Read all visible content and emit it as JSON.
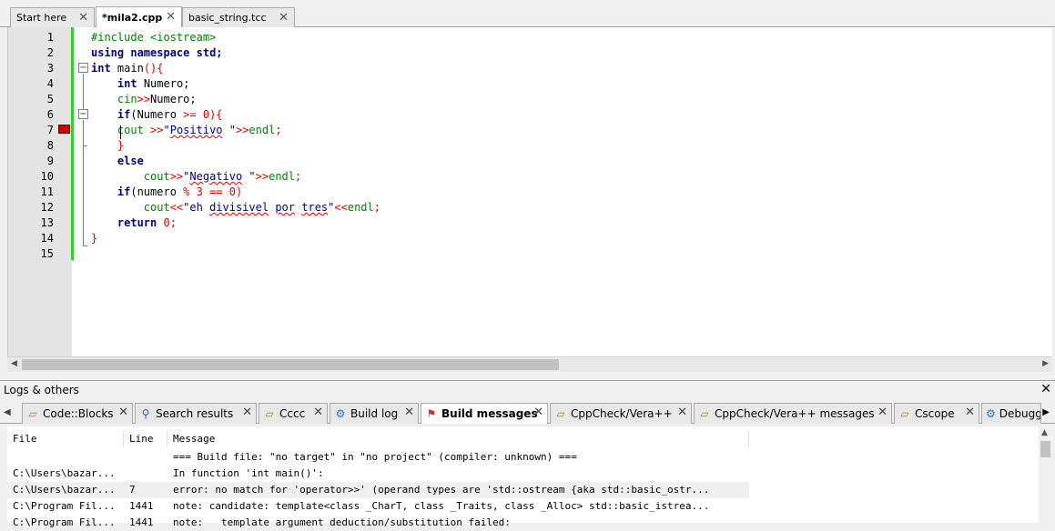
{
  "editor_tabs": [
    {
      "label": "Start here",
      "active": false
    },
    {
      "label": "*mila2.cpp",
      "active": true
    },
    {
      "label": "basic_string.tcc",
      "active": false
    }
  ],
  "tab_close_glyph": "✕",
  "code_lines": [
    {
      "num": "1"
    },
    {
      "num": "2"
    },
    {
      "num": "3"
    },
    {
      "num": "4"
    },
    {
      "num": "5"
    },
    {
      "num": "6"
    },
    {
      "num": "7"
    },
    {
      "num": "8"
    },
    {
      "num": "9"
    },
    {
      "num": "10"
    },
    {
      "num": "11"
    },
    {
      "num": "12"
    },
    {
      "num": "13"
    },
    {
      "num": "14"
    },
    {
      "num": "15"
    }
  ],
  "code": {
    "l1": "#include <iostream>",
    "l2_kw1": "using",
    "l2_kw2": "namespace",
    "l2_rest": "std;",
    "l3_kw": "int",
    "l3_name": "main",
    "l3_paren": "(){",
    "l4_kw": "int",
    "l4_rest": "Numero;",
    "l5_a": "cin",
    "l5_op": ">>",
    "l5_b": "Numero;",
    "l6_kw": "if",
    "l6_a": "(Numero ",
    "l6_op": ">=",
    "l6_num": "0",
    "l6_end": "){",
    "l7_a": "cout ",
    "l7_op": ">>",
    "l7_q1": "\"",
    "l7_word": "Positivo",
    "l7_q2": " \"",
    "l7_op2": ">>",
    "l7_endl": "endl",
    "l7_semi": ";",
    "l8": "}",
    "l9": "else",
    "l10_a": "cout",
    "l10_op": ">>",
    "l10_q1": "\"",
    "l10_word": "Negativo",
    "l10_q2": " \"",
    "l10_op2": ">>",
    "l10_endl": "endl",
    "l10_semi": ";",
    "l11_kw": "if",
    "l11_a": "(numero ",
    "l11_op": "%",
    "l11_num": "3",
    "l11_op2": "==",
    "l11_num2": "0",
    "l11_end": ")",
    "l12_a": "cout",
    "l12_op": "<<",
    "l12_q1": "\"eh ",
    "l12_w1": "divisivel",
    "l12_sp1": " ",
    "l12_w2": "por",
    "l12_sp2": " ",
    "l12_w3": "tres",
    "l12_q2": "\"",
    "l12_op2": "<<",
    "l12_endl": "endl",
    "l12_semi": ";",
    "l13_kw": "return",
    "l13_num": "0",
    "l13_semi": ";",
    "l14": "}"
  },
  "logs": {
    "title": "Logs & others",
    "close": "✕",
    "tabs": [
      {
        "label": "Code::Blocks",
        "icon": "document-icon"
      },
      {
        "label": "Search results",
        "icon": "magnifier-icon"
      },
      {
        "label": "Cccc",
        "icon": "document-icon"
      },
      {
        "label": "Build log",
        "icon": "gear-icon"
      },
      {
        "label": "Build messages",
        "icon": "pin-icon",
        "active": true
      },
      {
        "label": "CppCheck/Vera++",
        "icon": "document-icon"
      },
      {
        "label": "CppCheck/Vera++ messages",
        "icon": "document-icon"
      },
      {
        "label": "Cscope",
        "icon": "document-icon"
      },
      {
        "label": "Debugge",
        "icon": "gear-icon"
      }
    ],
    "columns": [
      "File",
      "Line",
      "Message"
    ],
    "rows": [
      {
        "file": "",
        "line": "",
        "message": "=== Build file: \"no target\" in \"no project\" (compiler: unknown) ==="
      },
      {
        "file": "C:\\Users\\bazar...",
        "line": "",
        "message": "In function 'int main()':"
      },
      {
        "file": "C:\\Users\\bazar...",
        "line": "7",
        "message": "error: no match for 'operator>>' (operand types are 'std::ostream {aka std::basic_ostr..."
      },
      {
        "file": "C:\\Program Fil...",
        "line": "1441",
        "message": "note: candidate: template<class _CharT, class _Traits, class _Alloc> std::basic_istrea..."
      },
      {
        "file": "C:\\Program Fil...",
        "line": "1441",
        "message": "note:   template argument deduction/substitution failed:"
      }
    ]
  },
  "colors": {
    "keyword": "#000080",
    "preprocessor": "#008000",
    "number": "#e00000",
    "change_bar": "#33cc33",
    "breakpoint": "#d00000"
  }
}
